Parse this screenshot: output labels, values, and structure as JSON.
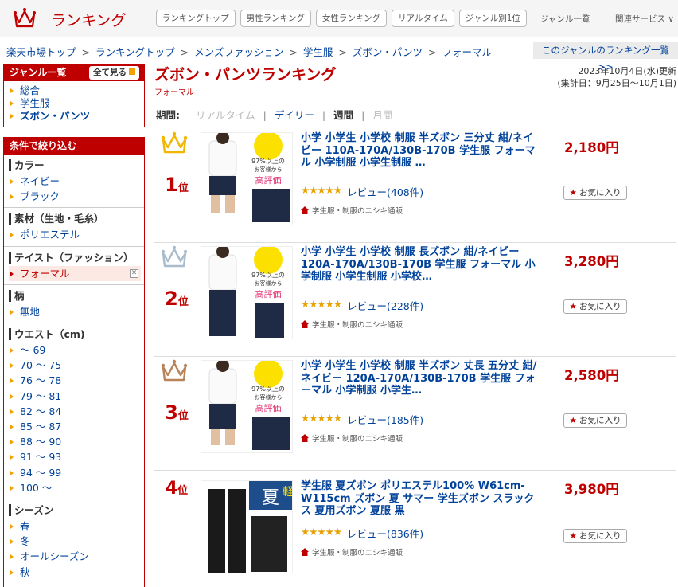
{
  "header": {
    "logo_text": "ランキング",
    "nav_pills": [
      "ランキングトップ",
      "男性ランキング",
      "女性ランキング",
      "リアルタイム",
      "ジャンル別1位"
    ],
    "genre_list": "ジャンル一覧",
    "related_services": "関連サービス ∨"
  },
  "breadcrumb": [
    "楽天市場トップ",
    "ランキングトップ",
    "メンズファッション",
    "学生服",
    "ズボン・パンツ",
    "フォーマル"
  ],
  "genre_ranking_link": "このジャンルのランキング一覧 >>",
  "sidebar": {
    "genre_title": "ジャンル一覧",
    "see_all": "全て見る",
    "genres": [
      "総合",
      "学生服",
      "ズボン・パンツ"
    ],
    "filter_title": "条件で絞り込む",
    "filters": [
      {
        "title": "カラー",
        "items": [
          "ネイビー",
          "ブラック"
        ]
      },
      {
        "title": "素材（生地・毛糸）",
        "items": [
          "ポリエステル"
        ]
      },
      {
        "title": "テイスト（ファッション）",
        "items": [
          "フォーマル"
        ]
      },
      {
        "title": "柄",
        "items": [
          "無地"
        ]
      },
      {
        "title": "ウエスト（cm)",
        "items": [
          "～ 69",
          "70 ～ 75",
          "76 ～ 78",
          "79 ～ 81",
          "82 ～ 84",
          "85 ～ 87",
          "88 ～ 90",
          "91 ～ 93",
          "94 ～ 99",
          "100 ～"
        ]
      },
      {
        "title": "シーズン",
        "items": [
          "春",
          "冬",
          "オールシーズン",
          "秋"
        ]
      }
    ],
    "clear_glyph": "✕"
  },
  "main": {
    "title": "ズボン・パンツランキング",
    "subtitle": "フォーマル",
    "updated_line1": "2023年10月4日(水)更新",
    "updated_line2": "(集計日：9月25日～10月1日)",
    "period_label": "期間:",
    "periods": [
      "リアルタイム",
      "デイリー",
      "週間",
      "月間"
    ]
  },
  "items": [
    {
      "rank": "1",
      "rank_suffix": "位",
      "title": "小学 小学生 小学校 制服 半ズボン 三分丈 紺/ネイビー 110A-170A/130B-170B 学生服 フォーマル 小学制服 小学生制服 …",
      "rating_stars": "★★★★★",
      "rating": 4.5,
      "review": "レビュー(408件)",
      "shop": "学生服・制服のニシキ通販",
      "price": "2,180円",
      "fav": "お気に入り",
      "crown_color": "#f2b600",
      "photo_badge": [
        "97%以上の",
        "お客様から",
        "高評価"
      ]
    },
    {
      "rank": "2",
      "rank_suffix": "位",
      "title": "小学 小学生 小学校 制服 長ズボン 紺/ネイビー 120A-170A/130B-170B 学生服 フォーマル 小学制服 小学生制服 小学校…",
      "rating_stars": "★★★★★",
      "rating": 4.5,
      "review": "レビュー(228件)",
      "shop": "学生服・制服のニシキ通販",
      "price": "3,280円",
      "fav": "お気に入り",
      "crown_color": "#a9bccc",
      "photo_badge": [
        "97%以上の",
        "お客様から",
        "高評価"
      ]
    },
    {
      "rank": "3",
      "rank_suffix": "位",
      "title": "小学 小学生 小学校 制服 半ズボン 丈長 五分丈 紺/ネイビー 120A-170A/130B-170B 学生服 フォーマル 小学制服 小学生…",
      "rating_stars": "★★★★★",
      "rating": 4.5,
      "review": "レビュー(185件)",
      "shop": "学生服・制服のニシキ通販",
      "price": "2,580円",
      "fav": "お気に入り",
      "crown_color": "#b9835a",
      "photo_badge": [
        "97%以上の",
        "お客様から",
        "高評価"
      ]
    },
    {
      "rank": "4",
      "rank_suffix": "位",
      "title": "学生服 夏ズボン ポリエステル100% W61cm-W115cm ズボン 夏 サマー 学生ズボン スラックス 夏用ズボン 夏服 黒",
      "rating_stars": "★★★★★",
      "rating": 4.5,
      "review": "レビュー(836件)",
      "shop": "学生服・制服のニシキ通販",
      "price": "3,980円",
      "fav": "お気に入り",
      "crown_color": "",
      "photo_badge": [
        "夏",
        "軽"
      ]
    }
  ],
  "colors": {
    "brand": "#bf0000",
    "link": "#00429a",
    "accent": "#f2a100"
  }
}
